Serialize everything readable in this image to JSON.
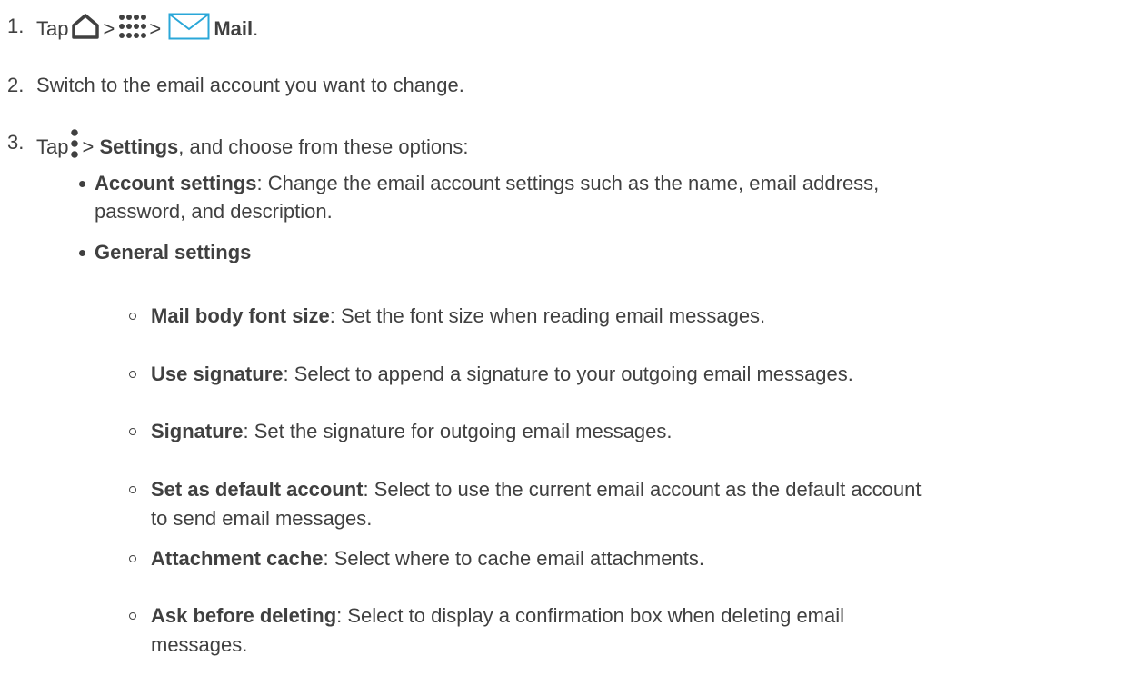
{
  "step1": {
    "num": "1.",
    "tap": "Tap",
    "sep1": ">",
    "sep2": ">",
    "mail": "Mail",
    "end": "."
  },
  "step2": {
    "num": "2.",
    "text": "Switch to the email account you want to change."
  },
  "step3": {
    "num": "3.",
    "tap": "Tap",
    "sep": ">",
    "settings": "Settings",
    "rest": ", and choose from these options:"
  },
  "options": {
    "account": {
      "term": "Account settings",
      "line1": ": Change the email account settings such as the name, email address,",
      "line2": "password, and description."
    },
    "general": {
      "term": "General settings"
    }
  },
  "general_items": [
    {
      "term": "Mail body font size",
      "desc": ": Set the font size when reading email messages."
    },
    {
      "term": "Use signature",
      "desc": ": Select to append a signature to your outgoing email messages."
    },
    {
      "term": "Signature",
      "desc": ": Set the signature for outgoing email messages."
    },
    {
      "term": "Set as default account",
      "desc": ": Select to use the current email account as the default account",
      "desc2": "to send email messages."
    },
    {
      "term": "Attachment cache",
      "desc": ": Select where to cache email attachments."
    },
    {
      "term": "Ask before deleting",
      "desc": ": Select to display a confirmation box when deleting email",
      "desc2": "messages."
    }
  ],
  "icons": {
    "home": "home-icon",
    "apps": "apps-grid-icon",
    "mail": "mail-envelope-icon",
    "menu": "overflow-menu-icon"
  },
  "colors": {
    "text": "#404040",
    "mail_icon": "#2aa7d8"
  }
}
